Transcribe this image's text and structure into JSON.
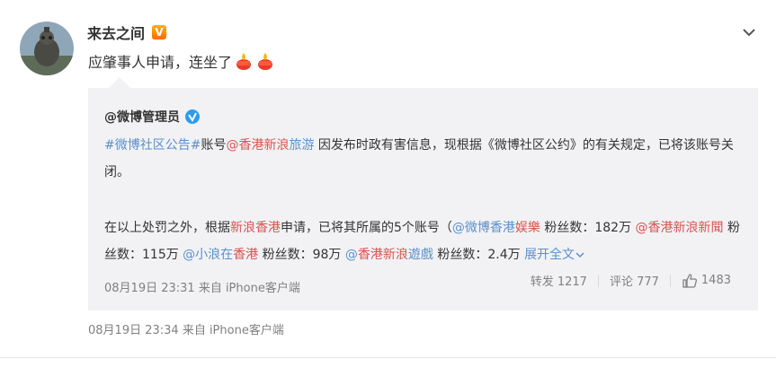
{
  "author": {
    "name": "来去之间",
    "vip_badge_text": "V",
    "avatar_icon": "robot-statue-avatar"
  },
  "post": {
    "text": "应肇事人申请，连坐了",
    "emoji_icons": [
      "candle-icon",
      "candle-icon"
    ]
  },
  "repost": {
    "author": "@微博管理员",
    "paragraph1": {
      "hashtag": "#微博社区公告#",
      "t1": "账号",
      "mention": "@香港新浪",
      "mention_tail": "旅游",
      "t2": " 因发布时政有害信息，现根据《微博社区公约》的有关规定，已将该账号关闭。"
    },
    "paragraph2": {
      "t1": "在以上处罚之外，根据",
      "red1": "新浪香港",
      "t2": "申请，已将其所属的5个账号（",
      "m1a": "@微博香港",
      "m1b": "娱樂",
      "f1": " 粉丝数：182万 ",
      "m2": "@香港新浪新聞",
      "f2": " 粉丝数：115万 ",
      "m3a": "@小浪在",
      "m3b": "香港",
      "f3": " 粉丝数：98万 ",
      "m4a": "@",
      "m4b": "香港新浪",
      "m4c": "遊戲",
      "f4": " 粉丝数：2.4万 ",
      "expand": "展开全文"
    },
    "meta": "08月19日 23:31 来自 iPhone客户端",
    "repost_label": "转发 1217",
    "comment_label": "评论 777",
    "like_count": "1483"
  },
  "post_meta": "08月19日 23:34 来自 iPhone客户端",
  "colors": {
    "link_blue": "#5b8fcd",
    "link_red": "#d9534f",
    "card_bg": "#f2f2f5",
    "meta_gray": "#808080"
  }
}
